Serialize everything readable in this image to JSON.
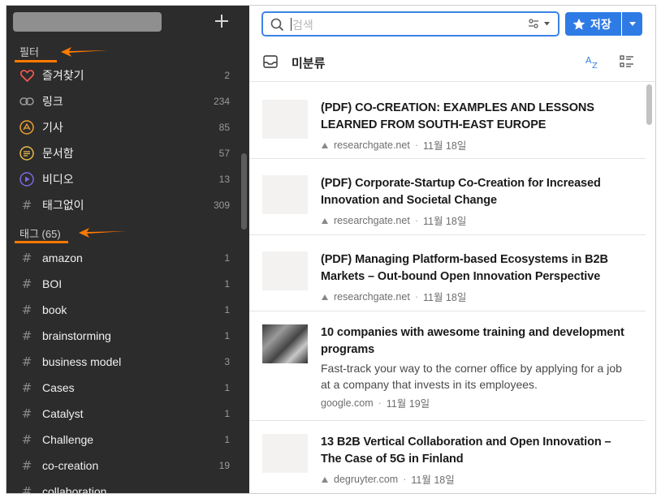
{
  "sidebar": {
    "filters_title": "필터",
    "filters": [
      {
        "label": "즐겨찾기",
        "count": "2",
        "icon": "heart-icon"
      },
      {
        "label": "링크",
        "count": "234",
        "icon": "link-icon"
      },
      {
        "label": "기사",
        "count": "85",
        "icon": "article-icon"
      },
      {
        "label": "문서함",
        "count": "57",
        "icon": "document-icon"
      },
      {
        "label": "비디오",
        "count": "13",
        "icon": "video-icon"
      },
      {
        "label": "태그없이",
        "count": "309",
        "icon": "hash-icon"
      }
    ],
    "tags_title": "태그 (65)",
    "tags": [
      {
        "label": "amazon",
        "count": "1"
      },
      {
        "label": "BOI",
        "count": "1"
      },
      {
        "label": "book",
        "count": "1"
      },
      {
        "label": "brainstorming",
        "count": "1"
      },
      {
        "label": "business model",
        "count": "3"
      },
      {
        "label": "Cases",
        "count": "1"
      },
      {
        "label": "Catalyst",
        "count": "1"
      },
      {
        "label": "Challenge",
        "count": "1"
      },
      {
        "label": "co-creation",
        "count": "19"
      },
      {
        "label": "collaboration",
        "count": ""
      }
    ]
  },
  "search": {
    "placeholder": "검색"
  },
  "toolbar": {
    "save_label": "저장"
  },
  "view": {
    "title": "미분류"
  },
  "items": [
    {
      "title": "(PDF) CO-CREATION: EXAMPLES AND LESSONS LEARNED FROM SOUTH-EAST EUROPE",
      "source": "researchgate.net",
      "date": "11월 18일"
    },
    {
      "title": "(PDF) Corporate-Startup Co-Creation for Increased Innovation and Societal Change",
      "source": "researchgate.net",
      "date": "11월 18일"
    },
    {
      "title": "(PDF) Managing Platform-based Ecosystems in B2B Markets – Out-bound Open Innovation Perspective",
      "source": "researchgate.net",
      "date": "11월 18일"
    },
    {
      "title": "10 companies with awesome training and development programs",
      "desc": "Fast-track your way to the corner office by applying for a job at a company that invests in its employees.",
      "source": "google.com",
      "date": "11월 19일"
    },
    {
      "title": "13 B2B Vertical Collaboration and Open Innovation – The Case of 5G in Finland",
      "source": "degruyter.com",
      "date": "11월 18일"
    }
  ],
  "colors": {
    "accent": "#2f7be5",
    "annotation": "#ff7a00",
    "sidebar_bg": "#2c2c2c"
  }
}
